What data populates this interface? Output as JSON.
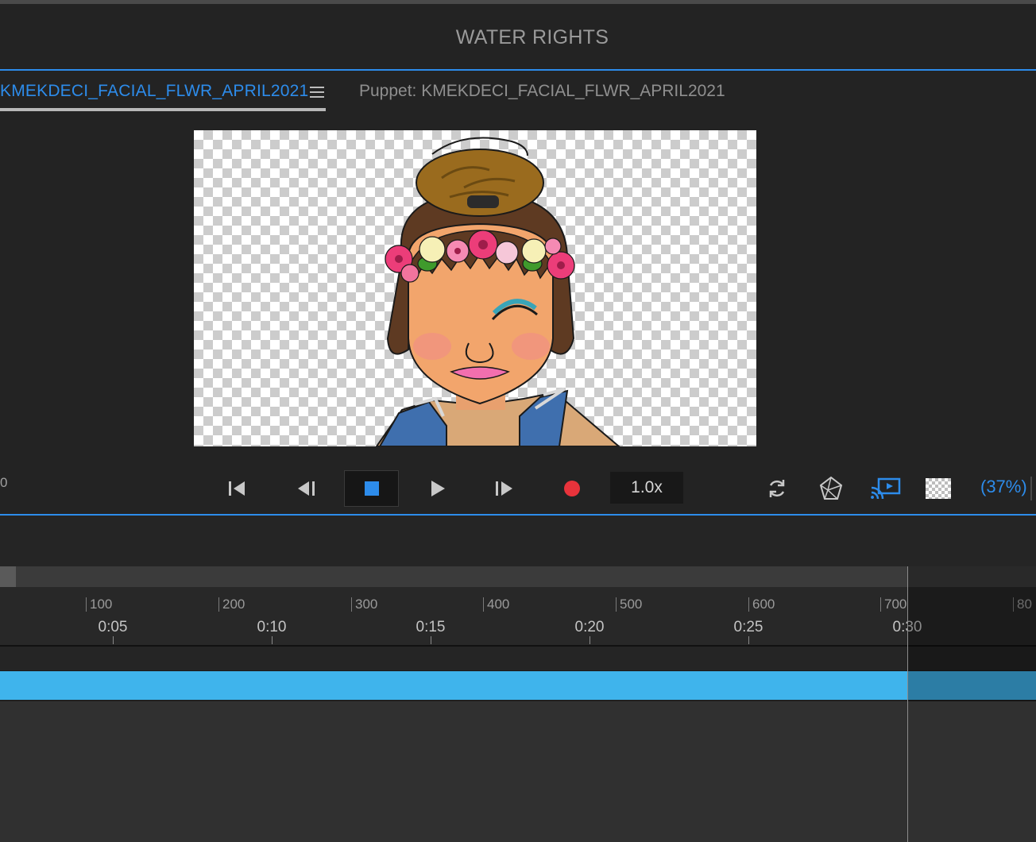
{
  "app": {
    "title": "WATER RIGHTS"
  },
  "tabs": {
    "active_label": "KMEKDECI_FACIAL_FLWR_APRIL2021",
    "puppet_label": "Puppet: KMEKDECI_FACIAL_FLWR_APRIL2021"
  },
  "transport": {
    "frame_counter": "0",
    "speed": "1.0x",
    "zoom": "(37%)",
    "buttons": [
      "go-to-start",
      "step-back",
      "stop",
      "play",
      "step-forward",
      "record"
    ],
    "tool_icons": [
      "refresh-icon",
      "3d-mesh-icon",
      "cast-preview-icon",
      "transparency-grid-icon"
    ]
  },
  "timeline": {
    "frame_labels": [
      "100",
      "200",
      "300",
      "400",
      "500",
      "600",
      "700",
      "80"
    ],
    "time_labels": [
      "0:05",
      "0:10",
      "0:15",
      "0:20",
      "0:25",
      "0:30"
    ]
  },
  "colors": {
    "accent": "#2d8ceb",
    "track": "#3fb4ec",
    "record": "#e8333b",
    "background": "#232323"
  }
}
